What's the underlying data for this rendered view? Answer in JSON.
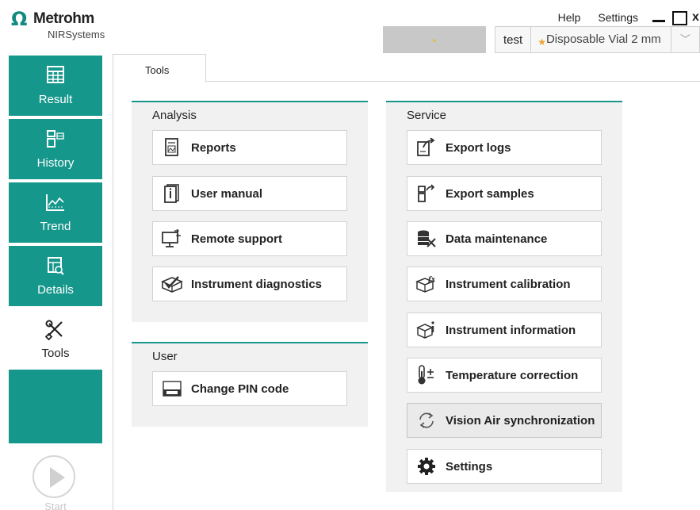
{
  "logo": {
    "brand": "Metrohm",
    "sub": "NIRSystems"
  },
  "menu": {
    "help": "Help",
    "settings": "Settings"
  },
  "window": {
    "close": "x"
  },
  "profile": {
    "user": "test",
    "product": "Disposable Vial 2 mm"
  },
  "sidebar": {
    "items": [
      {
        "label": "Result",
        "icon": "table-icon"
      },
      {
        "label": "History",
        "icon": "history-icon"
      },
      {
        "label": "Trend",
        "icon": "trend-chart-icon"
      },
      {
        "label": "Details",
        "icon": "details-icon"
      },
      {
        "label": "Tools",
        "icon": "tools-icon"
      }
    ],
    "start": "Start"
  },
  "tabs": [
    {
      "label": "Tools"
    }
  ],
  "analysis": {
    "title": "Analysis",
    "buttons": [
      {
        "label": "Reports",
        "icon": "report-icon"
      },
      {
        "label": "User manual",
        "icon": "manual-icon"
      },
      {
        "label": "Remote support",
        "icon": "remote-support-icon"
      },
      {
        "label": "Instrument diagnostics",
        "icon": "diagnostics-icon"
      }
    ]
  },
  "user": {
    "title": "User",
    "buttons": [
      {
        "label": "Change PIN code",
        "icon": "pin-icon"
      }
    ]
  },
  "service": {
    "title": "Service",
    "buttons": [
      {
        "label": "Export logs",
        "icon": "export-logs-icon"
      },
      {
        "label": "Export samples",
        "icon": "export-samples-icon"
      },
      {
        "label": "Data maintenance",
        "icon": "data-maintenance-icon"
      },
      {
        "label": "Instrument calibration",
        "icon": "calibration-icon"
      },
      {
        "label": "Instrument information",
        "icon": "info-icon"
      },
      {
        "label": "Temperature correction",
        "icon": "thermometer-icon"
      },
      {
        "label": "Vision Air synchronization",
        "icon": "sync-icon"
      },
      {
        "label": "Settings",
        "icon": "gear-icon"
      }
    ]
  },
  "colors": {
    "accent": "#16978c",
    "panel": "#f1f1f1"
  }
}
